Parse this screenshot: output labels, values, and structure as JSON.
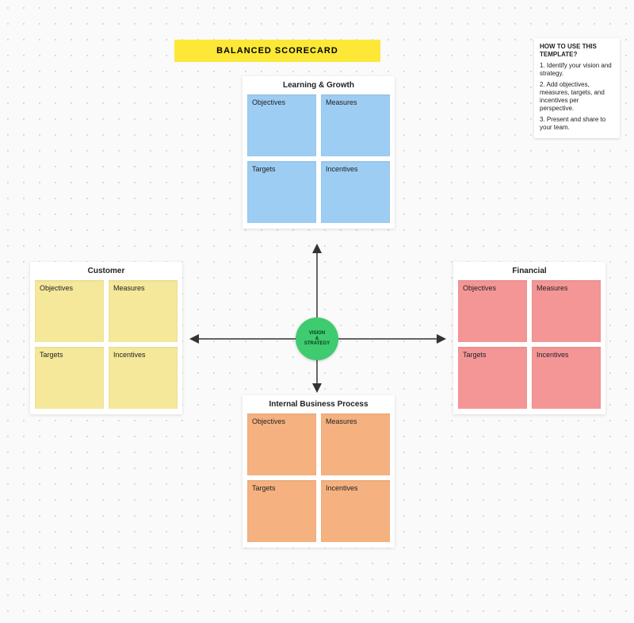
{
  "title": "BALANCED SCORECARD",
  "center": {
    "line1": "VISION",
    "line2": "&",
    "line3": "STRATEGY"
  },
  "instructions": {
    "heading": "HOW TO USE THIS TEMPLATE?",
    "step1": "1. Identify your vision and strategy.",
    "step2": "2. Add objectives, measures, targets, and incentives per perspective.",
    "step3": "3. Present and share to your team."
  },
  "panels": {
    "top": {
      "title": "Learning & Growth",
      "cards": {
        "0": "Objectives",
        "1": "Measures",
        "2": "Targets",
        "3": "Incentives"
      }
    },
    "left": {
      "title": "Customer",
      "cards": {
        "0": "Objectives",
        "1": "Measures",
        "2": "Targets",
        "3": "Incentives"
      }
    },
    "right": {
      "title": "Financial",
      "cards": {
        "0": "Objectives",
        "1": "Measures",
        "2": "Targets",
        "3": "Incentives"
      }
    },
    "bottom": {
      "title": "Internal Business Process",
      "cards": {
        "0": "Objectives",
        "1": "Measures",
        "2": "Targets",
        "3": "Incentives"
      }
    }
  }
}
